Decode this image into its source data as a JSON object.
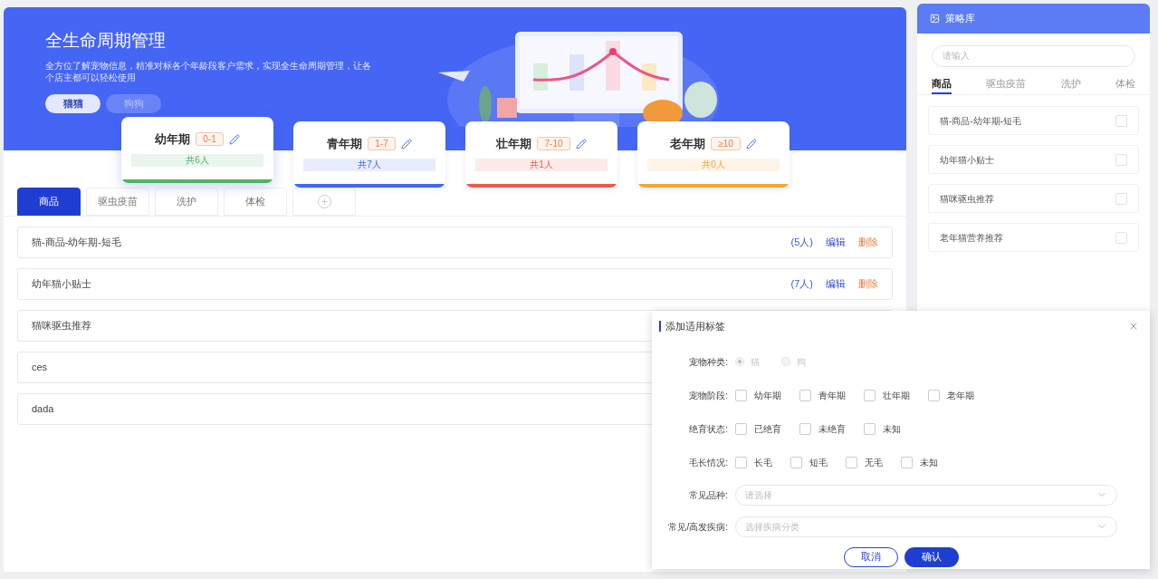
{
  "banner": {
    "title": "全生命周期管理",
    "subtitle": "全方位了解宠物信息，精准对标各个年龄段客户需求，实现全生命周期管理，让各个店主都可以轻松使用",
    "pet_tabs": [
      {
        "label": "猫猫",
        "selected": true
      },
      {
        "label": "狗狗",
        "selected": false
      }
    ]
  },
  "stages": [
    {
      "name": "幼年期",
      "range": "0-1",
      "count": "共6人",
      "color": "#52b06a",
      "selected": true
    },
    {
      "name": "青年期",
      "range": "1-7",
      "count": "共7人",
      "color": "#4466f2",
      "selected": false
    },
    {
      "name": "壮年期",
      "range": "7-10",
      "count": "共1人",
      "color": "#ea5a4e",
      "selected": false
    },
    {
      "name": "老年期",
      "range": "≥10",
      "count": "共0人",
      "color": "#f3a637",
      "selected": false
    }
  ],
  "tabs": [
    {
      "label": "商品",
      "selected": true
    },
    {
      "label": "驱虫疫苗",
      "selected": false
    },
    {
      "label": "洗护",
      "selected": false
    },
    {
      "label": "体检",
      "selected": false
    }
  ],
  "strategies": [
    {
      "name": "猫-商品-幼年期-短毛",
      "people": "(5人)",
      "edit": "编辑",
      "delete": "删除"
    },
    {
      "name": "幼年猫小贴士",
      "people": "(7人)",
      "edit": "编辑",
      "delete": "删除"
    },
    {
      "name": "猫咪驱虫推荐"
    },
    {
      "name": "ces"
    },
    {
      "name": "dada"
    }
  ],
  "library": {
    "title": "策略库",
    "search_placeholder": "请输入",
    "tabs": [
      {
        "label": "商品",
        "selected": true
      },
      {
        "label": "驱虫疫苗",
        "selected": false
      },
      {
        "label": "洗护",
        "selected": false
      },
      {
        "label": "体检",
        "selected": false
      }
    ],
    "items": [
      {
        "name": "猫-商品-幼年期-短毛",
        "checked": false
      },
      {
        "name": "幼年猫小贴士",
        "checked": false
      },
      {
        "name": "猫咪驱虫推荐",
        "checked": false
      },
      {
        "name": "老年猫营养推荐",
        "checked": false
      }
    ]
  },
  "dialog": {
    "title": "添加适用标签",
    "fields": [
      {
        "kind": "radio",
        "label": "宠物种类:",
        "disabled": true,
        "options": [
          {
            "label": "猫",
            "selected": true
          },
          {
            "label": "狗",
            "selected": false
          }
        ]
      },
      {
        "kind": "checkbox",
        "label": "宠物阶段:",
        "options": [
          {
            "label": "幼年期",
            "checked": false
          },
          {
            "label": "青年期",
            "checked": false
          },
          {
            "label": "壮年期",
            "checked": false
          },
          {
            "label": "老年期",
            "checked": false
          }
        ]
      },
      {
        "kind": "checkbox",
        "label": "绝育状态:",
        "options": [
          {
            "label": "已绝育",
            "checked": false
          },
          {
            "label": "未绝育",
            "checked": false
          },
          {
            "label": "未知",
            "checked": false
          }
        ]
      },
      {
        "kind": "checkbox",
        "label": "毛长情况:",
        "options": [
          {
            "label": "长毛",
            "checked": false
          },
          {
            "label": "短毛",
            "checked": false
          },
          {
            "label": "无毛",
            "checked": false
          },
          {
            "label": "未知",
            "checked": false
          }
        ]
      },
      {
        "kind": "select",
        "label": "常见品种:",
        "placeholder": "请选择"
      },
      {
        "kind": "select",
        "label": "常见/高发疾病:",
        "placeholder": "选择疾病分类"
      }
    ],
    "cancel": "取消",
    "confirm": "确认"
  }
}
